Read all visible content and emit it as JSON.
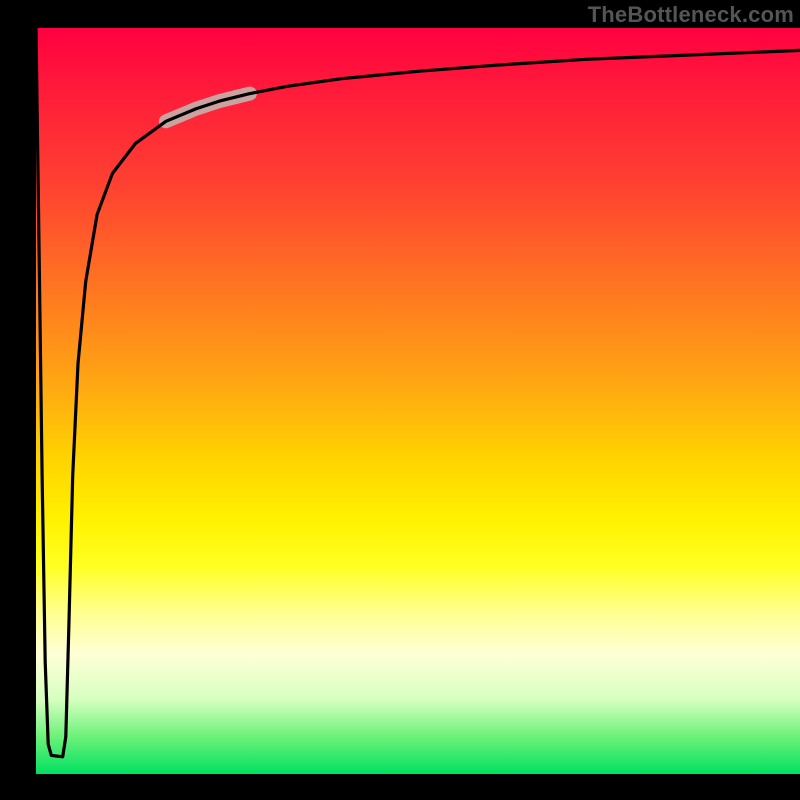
{
  "watermark": "TheBottleneck.com",
  "colors": {
    "page_bg": "#000000",
    "gradient_top": "#ff0040",
    "gradient_bottom": "#00e060",
    "curve_stroke": "#000000",
    "highlight": "#caa2a0"
  },
  "chart_data": {
    "type": "line",
    "title": "",
    "xlabel": "",
    "ylabel": "",
    "xlim": [
      0,
      100
    ],
    "ylim": [
      0,
      100
    ],
    "grid": false,
    "legend": false,
    "series": [
      {
        "name": "bottleneck-curve",
        "x": [
          0,
          0.4,
          0.8,
          1.2,
          1.6,
          2.0,
          3.5,
          3.9,
          4.3,
          4.8,
          5.5,
          6.5,
          8,
          10,
          13,
          17,
          21,
          24,
          28,
          33,
          40,
          50,
          60,
          72,
          86,
          100
        ],
        "y": [
          100,
          70,
          40,
          15,
          4,
          2.5,
          2.3,
          5,
          20,
          40,
          55,
          66,
          75,
          80.5,
          84.5,
          87.5,
          89.2,
          90.2,
          91.2,
          92.2,
          93.2,
          94.2,
          95,
          95.8,
          96.4,
          97
        ]
      }
    ],
    "annotations": [
      {
        "name": "highlight-segment",
        "x_range": [
          17,
          28
        ],
        "description": "short pale highlighted band on the rising curve"
      }
    ]
  }
}
